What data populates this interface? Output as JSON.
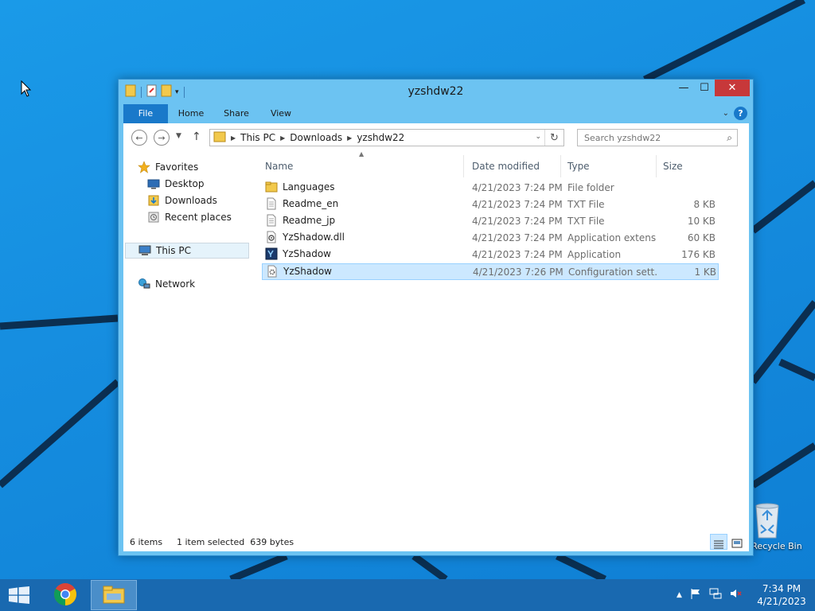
{
  "window": {
    "title": "yzshdw22",
    "controls": {
      "minimize": "—",
      "maximize": "☐",
      "close": "✕"
    }
  },
  "ribbon": {
    "tabs": [
      "File",
      "Home",
      "Share",
      "View"
    ]
  },
  "navigation": {
    "path": [
      "This PC",
      "Downloads",
      "yzshdw22"
    ],
    "search_placeholder": "Search yzshdw22"
  },
  "nav_pane": {
    "favorites_label": "Favorites",
    "favorites": [
      "Desktop",
      "Downloads",
      "Recent places"
    ],
    "this_pc": "This PC",
    "network": "Network"
  },
  "columns": [
    "Name",
    "Date modified",
    "Type",
    "Size"
  ],
  "files": [
    {
      "name": "Languages",
      "date": "4/21/2023 7:24 PM",
      "type": "File folder",
      "size": "",
      "icon": "folder-icon"
    },
    {
      "name": "Readme_en",
      "date": "4/21/2023 7:24 PM",
      "type": "TXT File",
      "size": "8 KB",
      "icon": "text-file-icon"
    },
    {
      "name": "Readme_jp",
      "date": "4/21/2023 7:24 PM",
      "type": "TXT File",
      "size": "10 KB",
      "icon": "text-file-icon"
    },
    {
      "name": "YzShadow.dll",
      "date": "4/21/2023 7:24 PM",
      "type": "Application extens...",
      "size": "60 KB",
      "icon": "dll-file-icon"
    },
    {
      "name": "YzShadow",
      "date": "4/21/2023 7:24 PM",
      "type": "Application",
      "size": "176 KB",
      "icon": "application-icon"
    },
    {
      "name": "YzShadow",
      "date": "4/21/2023 7:26 PM",
      "type": "Configuration sett...",
      "size": "1 KB",
      "icon": "config-file-icon"
    }
  ],
  "status": {
    "item_count": "6 items",
    "selection": "1 item selected  639 bytes"
  },
  "desktop": {
    "recycle_bin": "Recycle Bin"
  },
  "taskbar": {
    "time": "7:34 PM",
    "date": "4/21/2023"
  }
}
